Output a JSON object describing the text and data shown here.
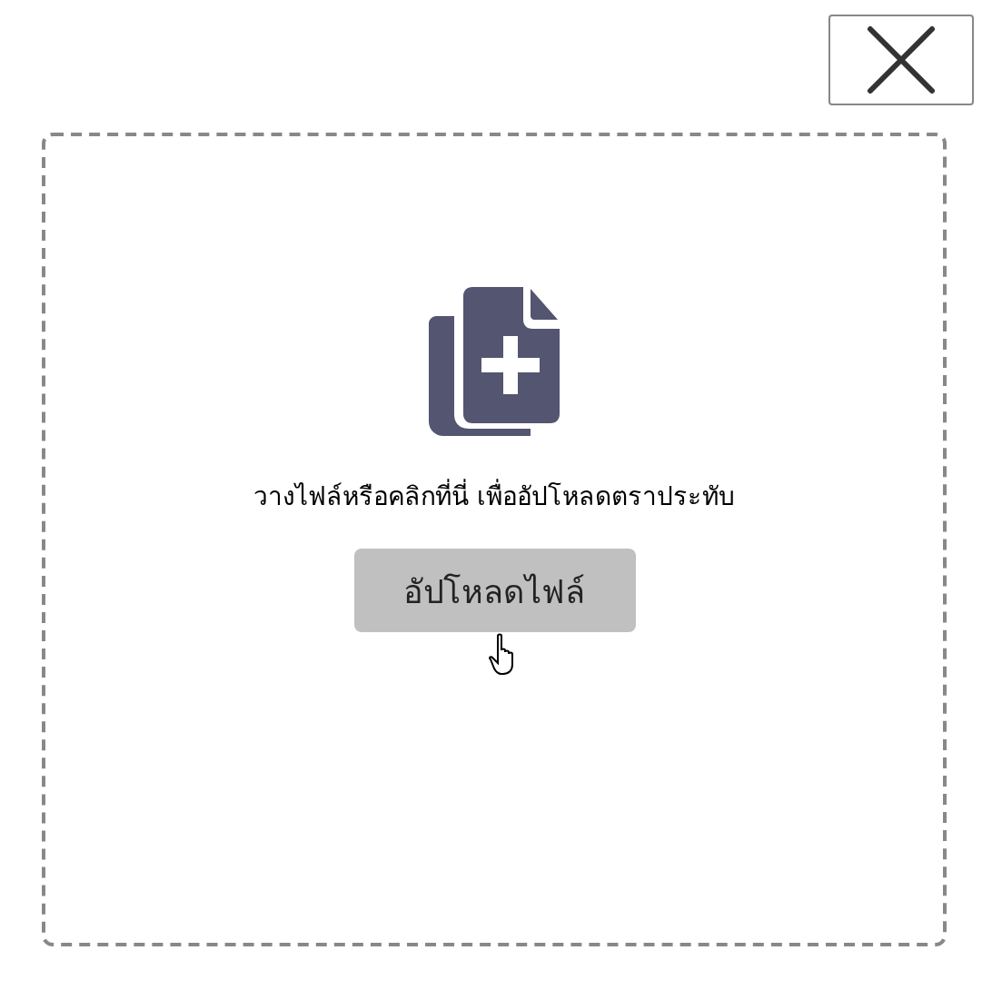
{
  "dropzone": {
    "instruction": "วางไฟล์หรือคลิกที่นี่ เพื่ออัปโหลดตราประทับ",
    "button": "อัปโหลดไฟล์"
  }
}
